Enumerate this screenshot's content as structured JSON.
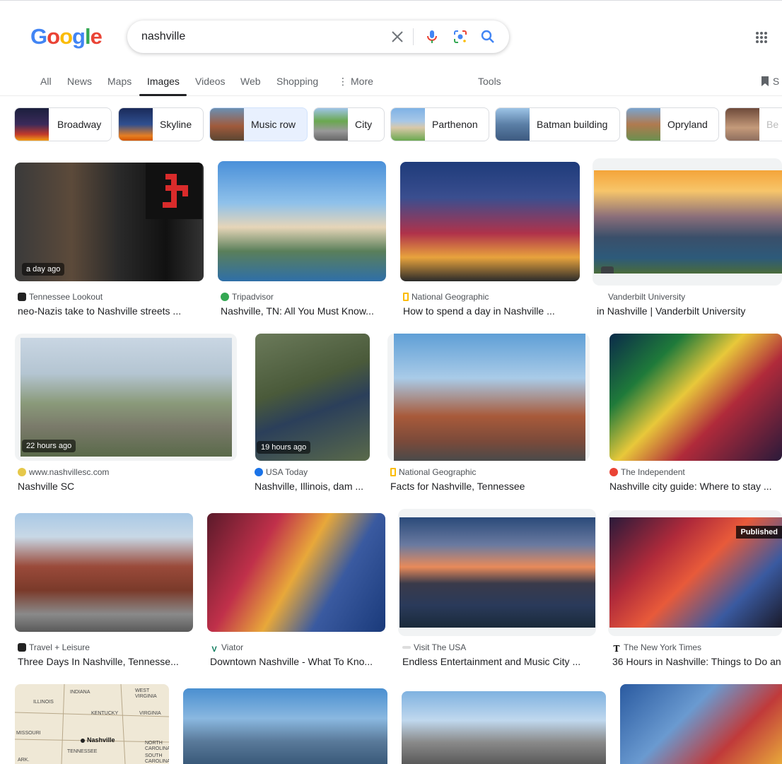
{
  "search": {
    "query": "nashville"
  },
  "logo": [
    "G",
    "o",
    "o",
    "g",
    "l",
    "e"
  ],
  "tabs": [
    "All",
    "News",
    "Maps",
    "Images",
    "Videos",
    "Web",
    "Shopping",
    "More",
    "Tools"
  ],
  "saved_label": "S",
  "chips": [
    "Broadway",
    "Skyline",
    "Music row",
    "City",
    "Parthenon",
    "Batman building",
    "Opryland",
    "Be"
  ],
  "results": [
    {
      "source": "Tennessee Lookout",
      "title": "neo-Nazis take to Nashville streets ...",
      "badge": "a day ago"
    },
    {
      "source": "Tripadvisor",
      "title": "Nashville, TN: All You Must Know..."
    },
    {
      "source": "National Geographic",
      "title": "How to spend a day in Nashville ..."
    },
    {
      "source": "Vanderbilt University",
      "title": "in Nashville | Vanderbilt University"
    },
    {
      "source": "www.nashvillesc.com",
      "title": "Nashville SC",
      "badge": "22 hours ago"
    },
    {
      "source": "USA Today",
      "title": "Nashville, Illinois, dam ...",
      "badge": "19 hours ago"
    },
    {
      "source": "National Geographic",
      "title": "Facts for Nashville, Tennessee"
    },
    {
      "source": "The Independent",
      "title": "Nashville city guide: Where to stay ..."
    },
    {
      "source": "Travel + Leisure",
      "title": "Three Days In Nashville, Tennesse..."
    },
    {
      "source": "Viator",
      "title": "Downtown Nashville - What To Kno..."
    },
    {
      "source": "Visit The USA",
      "title": "Endless Entertainment and Music City ..."
    },
    {
      "source": "The New York Times",
      "title": "36 Hours in Nashville: Things to Do an",
      "published": "Published"
    }
  ],
  "map_labels": [
    "INDIANA",
    "ILLINOIS",
    "WEST VIRGINIA",
    "KENTUCKY",
    "VIRGINIA",
    "MISSOURI",
    "Nashville",
    "TENNESSEE",
    "NORTH CAROLINA",
    "ARK.",
    "SOUTH CAROLINA"
  ],
  "colors": {
    "blue": "#4285f4",
    "red": "#ea4335",
    "yellow": "#fbbc05",
    "green": "#34a853",
    "selected_chip": "#e8f0fe"
  }
}
